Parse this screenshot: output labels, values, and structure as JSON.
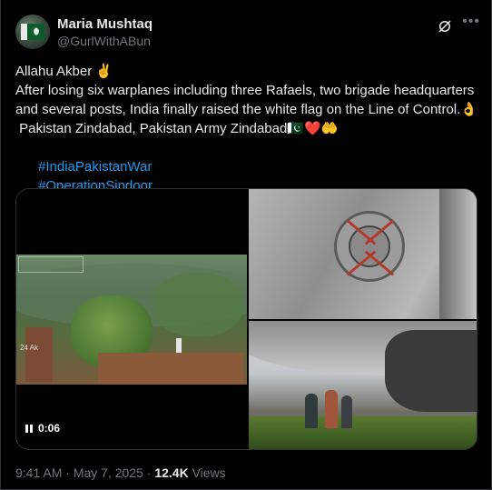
{
  "author": {
    "name": "Maria Mushtaq",
    "handle": "@GurlWithABun"
  },
  "tweet": {
    "line1": "Allahu Akber ✌️",
    "line2": "After losing six warplanes including three Rafaels, two brigade headquarters and several posts, India finally raised the white flag on the Line of Control.👌",
    "line3": " Pakistan Zindabad, Pakistan Army Zindabad🇵🇰❤️🤲",
    "hashtags": [
      "#IndiaPakistanWar",
      "#OperationSindoor"
    ]
  },
  "media": {
    "video_time": "0:06",
    "video_overlay": "24 Ak"
  },
  "meta": {
    "time": "9:41 AM",
    "separator": "·",
    "date": "May 7, 2025",
    "views_count": "12.4K",
    "views_label": "Views"
  },
  "icons": {
    "grok": "grok-icon",
    "more": "more-icon",
    "pause": "pause-icon"
  }
}
